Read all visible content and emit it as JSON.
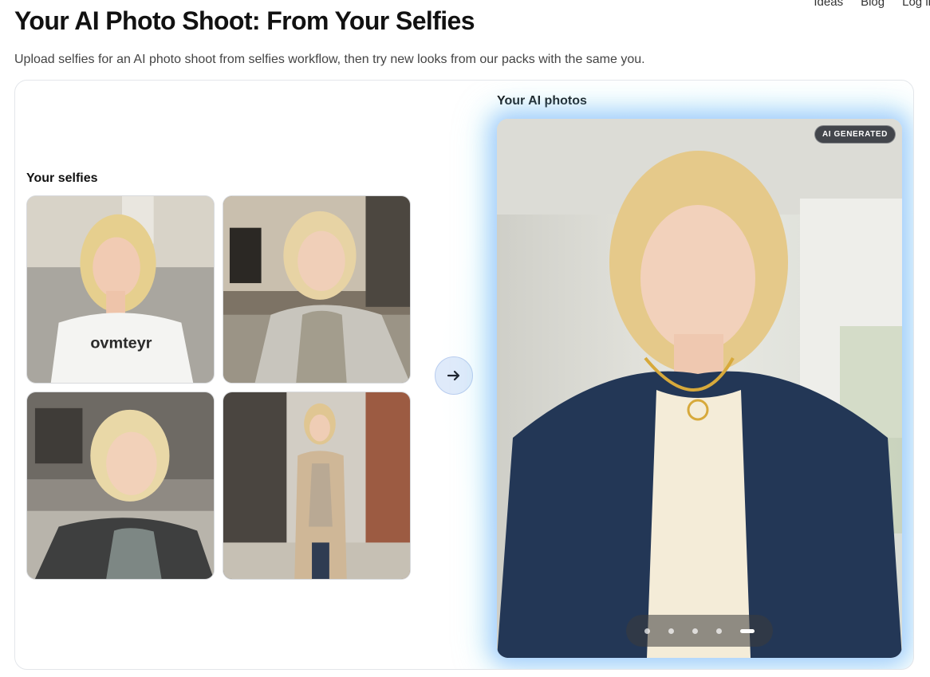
{
  "nav": {
    "items": [
      "Ideas",
      "Blog",
      "Log in"
    ]
  },
  "header": {
    "title": "Your AI Photo Shoot: From Your Selfies",
    "subtitle": "Upload selfies for an AI photo shoot from selfies workflow, then try new looks from our packs with the same you."
  },
  "selfies": {
    "heading": "Your selfies",
    "shirt_text": "ovmteyr"
  },
  "ai_photos": {
    "heading": "Your AI photos",
    "badge": "AI GENERATED",
    "slide_count": 5,
    "active_slide": 5
  },
  "colors": {
    "glow_blue": "#7aa8ff",
    "glow_cyan": "#82e1eb",
    "arrow_bg": "#dfeafa"
  }
}
